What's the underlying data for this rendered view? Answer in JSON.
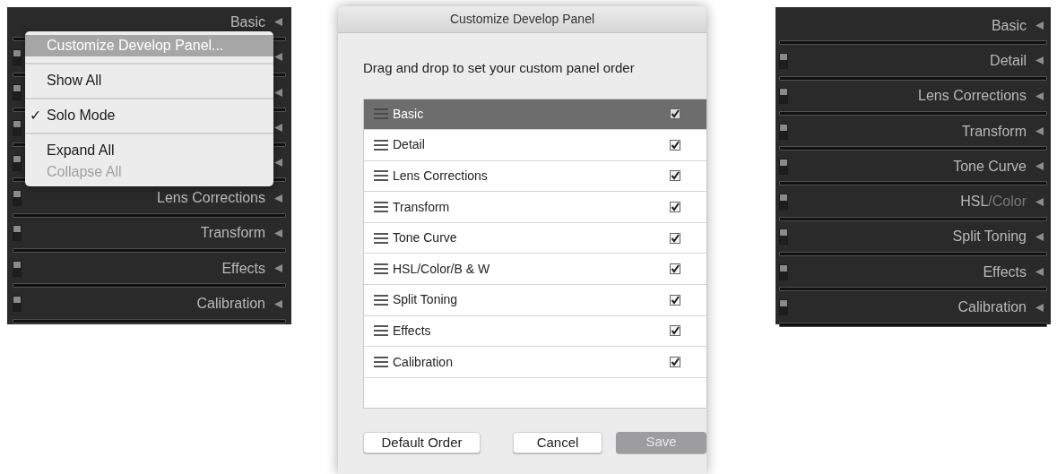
{
  "left_panel": {
    "rows": [
      {
        "label": "Basic",
        "switch": false
      },
      {
        "switch": true
      },
      {
        "switch": true
      },
      {
        "switch": true
      },
      {
        "switch": true
      },
      {
        "label": "Lens Corrections",
        "switch": true
      },
      {
        "label": "Transform",
        "switch": true
      },
      {
        "label": "Effects",
        "switch": true
      },
      {
        "label": "Calibration",
        "switch": true
      }
    ]
  },
  "context_menu": {
    "items": [
      {
        "label": "Customize Develop Panel...",
        "selected": true,
        "checked": false,
        "disabled": false,
        "separator_after": true
      },
      {
        "label": "Show All",
        "selected": false,
        "checked": false,
        "disabled": false,
        "separator_after": true
      },
      {
        "label": "Solo Mode",
        "selected": false,
        "checked": true,
        "disabled": false,
        "separator_after": true
      },
      {
        "label": "Expand All",
        "selected": false,
        "checked": false,
        "disabled": false,
        "separator_after": false
      },
      {
        "label": "Collapse All",
        "selected": false,
        "checked": false,
        "disabled": true,
        "separator_after": false
      }
    ]
  },
  "check_mark": "✓",
  "dialog": {
    "title": "Customize Develop Panel",
    "instruction": "Drag and drop to set your custom panel order",
    "items": [
      {
        "label": "Basic",
        "selected": true,
        "checked": true
      },
      {
        "label": "Detail",
        "selected": false,
        "checked": true
      },
      {
        "label": "Lens Corrections",
        "selected": false,
        "checked": true
      },
      {
        "label": "Transform",
        "selected": false,
        "checked": true
      },
      {
        "label": "Tone Curve",
        "selected": false,
        "checked": true
      },
      {
        "label": "HSL/Color/B & W",
        "selected": false,
        "checked": true
      },
      {
        "label": "Split Toning",
        "selected": false,
        "checked": true
      },
      {
        "label": "Effects",
        "selected": false,
        "checked": true
      },
      {
        "label": "Calibration",
        "selected": false,
        "checked": true
      }
    ],
    "buttons": [
      {
        "label": "Default Order",
        "disabled": false
      },
      {
        "label": "Cancel",
        "disabled": false
      },
      {
        "label": "Save",
        "disabled": true
      }
    ]
  },
  "right_panel": {
    "rows": [
      {
        "label": "Basic",
        "switch": false
      },
      {
        "label": "Detail",
        "switch": true
      },
      {
        "label": "Lens Corrections",
        "switch": true
      },
      {
        "label": "Transform",
        "switch": true
      },
      {
        "label": "Tone Curve",
        "switch": true
      },
      {
        "label": "HSL",
        "label_dim": "/Color",
        "switch": true
      },
      {
        "label": "Split Toning",
        "switch": true
      },
      {
        "label": "Effects",
        "switch": true
      },
      {
        "label": "Calibration",
        "switch": true
      }
    ]
  }
}
